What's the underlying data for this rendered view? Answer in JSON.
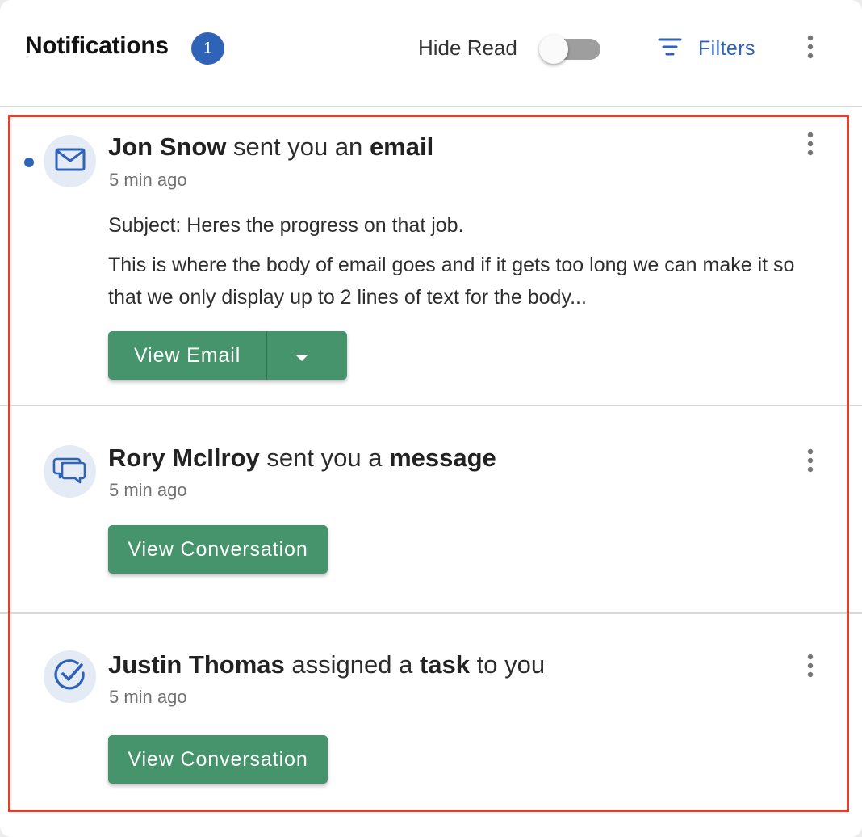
{
  "header": {
    "title": "Notifications",
    "unread_count": "1",
    "hide_read_label": "Hide Read",
    "hide_read_on": false,
    "filters_label": "Filters"
  },
  "colors": {
    "brand_blue": "#2f63b8",
    "action_green": "#46946b",
    "highlight_outline": "#e0402e",
    "avatar_bg": "#e4ebf5"
  },
  "notifications": [
    {
      "unread": true,
      "icon": "mail-icon",
      "actor": "Jon Snow",
      "action_text": "sent you an",
      "object": "email",
      "suffix": "",
      "time": "5 min ago",
      "subject": "Subject: Heres the progress on that job.",
      "body": "This is where the body of email goes and if it gets too long we can make it so that we only display up to 2 lines of text for the body...",
      "button_label": "View Email",
      "has_dropdown": true
    },
    {
      "unread": false,
      "icon": "chat-bubbles-icon",
      "actor": "Rory McIlroy",
      "action_text": "sent you a",
      "object": "message",
      "suffix": "",
      "time": "5 min ago",
      "button_label": "View Conversation"
    },
    {
      "unread": false,
      "icon": "task-check-icon",
      "actor": "Justin Thomas",
      "action_text": "assigned a",
      "object": "task",
      "suffix": "to you",
      "time": "5 min ago",
      "button_label": "View Conversation"
    }
  ]
}
